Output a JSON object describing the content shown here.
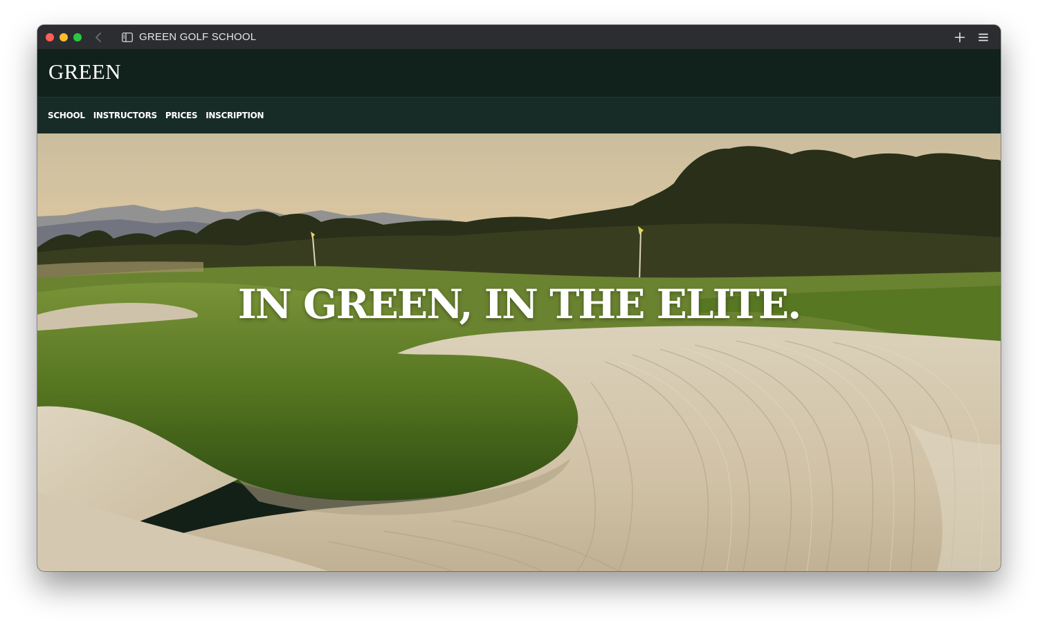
{
  "browser": {
    "tab_title": "GREEN GOLF SCHOOL",
    "icons": {
      "back": "chevron-left-icon",
      "sidebar": "sidebar-icon",
      "new_tab": "plus-icon",
      "menu": "hamburger-menu-icon"
    },
    "colors": {
      "titlebar": "#2b2d31",
      "close": "#fe5f57",
      "minimize": "#febc2e",
      "maximize": "#28c840"
    }
  },
  "site": {
    "logo": "GREEN",
    "nav": [
      {
        "label": "SCHOOL"
      },
      {
        "label": "INSTRUCTORS"
      },
      {
        "label": "PRICES"
      },
      {
        "label": "INSCRIPTION"
      }
    ],
    "colors": {
      "header_bg": "#11211b",
      "nav_bg": "#182c27",
      "text": "#ffffff"
    }
  },
  "hero": {
    "headline": "IN GREEN, IN THE ELITE.",
    "image": "golf-course-bunker-sunset-photo"
  }
}
